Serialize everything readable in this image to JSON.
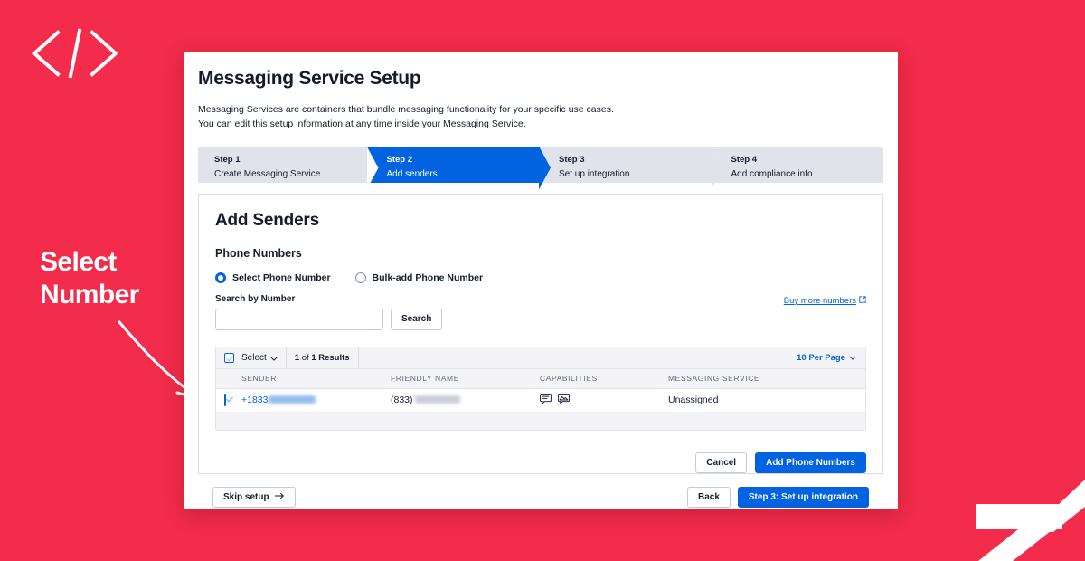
{
  "theme": {
    "background_red": "#F22C4A",
    "accent_blue": "#0263E0",
    "text_dark": "#121C2D",
    "muted_gray": "#606B85"
  },
  "decor": {
    "logo_icon": "code-brackets-icon",
    "corner_mark": "seven-swoosh-shape"
  },
  "annotation": {
    "line1": "Select",
    "line2": "Number",
    "arrow_icon": "curved-arrow-icon"
  },
  "window": {
    "title": "Messaging Service Setup",
    "description_line1": "Messaging Services are containers that bundle messaging functionality for your specific use cases.",
    "description_line2": "You can edit this setup information at any time inside your Messaging Service.",
    "stepper": [
      {
        "num": "Step 1",
        "label": "Create Messaging Service",
        "active": false
      },
      {
        "num": "Step 2",
        "label": "Add senders",
        "active": true
      },
      {
        "num": "Step 3",
        "label": "Set up integration",
        "active": false
      },
      {
        "num": "Step 4",
        "label": "Add compliance info",
        "active": false
      }
    ],
    "card": {
      "title": "Add Senders",
      "section_label": "Phone Numbers",
      "radios": [
        {
          "label": "Select Phone Number",
          "selected": true
        },
        {
          "label": "Bulk-add Phone Number",
          "selected": false
        }
      ],
      "search": {
        "label": "Search by Number",
        "value": "",
        "placeholder": "",
        "button_label": "Search"
      },
      "buy_link": {
        "label": "Buy more numbers",
        "icon": "external-link-icon"
      },
      "table": {
        "toolbar": {
          "select_label": "Select",
          "select_chevron": "chevron-down-icon",
          "results_count": "1",
          "results_of": "of",
          "results_total": "1 Results",
          "per_page_label": "10 Per Page",
          "per_page_chevron": "chevron-down-icon"
        },
        "headers": [
          "SENDER",
          "FRIENDLY NAME",
          "CAPABILITIES",
          "MESSAGING SERVICE"
        ],
        "rows": [
          {
            "checked": true,
            "sender_prefix": "+1833",
            "sender_redacted": true,
            "friendly_prefix": "(833)",
            "friendly_redacted": true,
            "capabilities": [
              "sms-icon",
              "mms-icon"
            ],
            "messaging_service": "Unassigned"
          }
        ]
      },
      "actions": {
        "cancel_label": "Cancel",
        "submit_label": "Add Phone Numbers"
      }
    },
    "footer": {
      "skip_label": "Skip setup",
      "skip_icon": "arrow-right-icon",
      "back_label": "Back",
      "next_label": "Step 3: Set up integration"
    }
  }
}
